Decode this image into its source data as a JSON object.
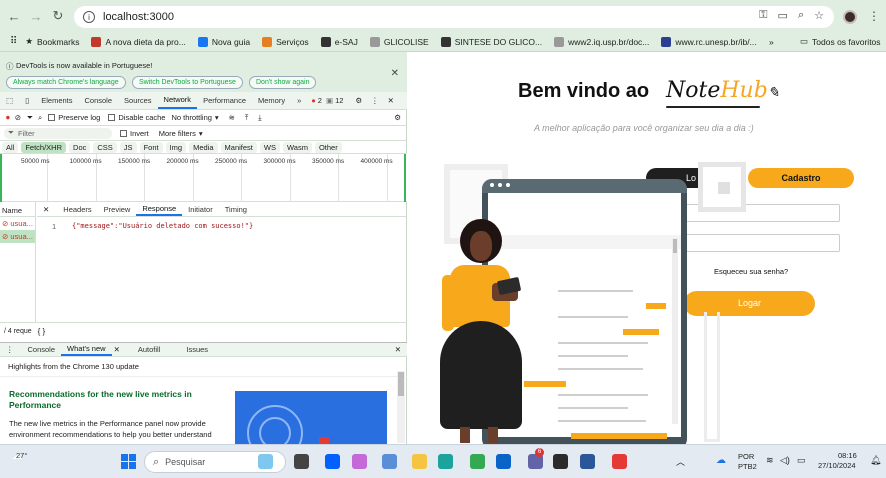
{
  "browser": {
    "url": "localhost:3000",
    "bookmarks_label": "Bookmarks",
    "bookmarks": [
      {
        "label": "A nova dieta da pro...",
        "color": "#c0392b"
      },
      {
        "label": "Nova guia",
        "color": "#1877f2"
      },
      {
        "label": "Serviços",
        "color": "#e67e22"
      },
      {
        "label": "e-SAJ",
        "color": "#333333"
      },
      {
        "label": "GLICOLISE",
        "color": "#999999"
      },
      {
        "label": "SINTESE DO GLICO...",
        "color": "#333333"
      },
      {
        "label": "www2.iq.usp.br/doc...",
        "color": "#999999"
      },
      {
        "label": "www.rc.unesp.br/ib/...",
        "color": "#2c3e90"
      }
    ],
    "all_favorites": "Todos os favoritos"
  },
  "devtools": {
    "info_text": "DevTools is now available in Portuguese!",
    "btn_match": "Always match Chrome's language",
    "btn_switch": "Switch DevTools to Portuguese",
    "btn_dont": "Don't show again",
    "tabs": [
      "Elements",
      "Console",
      "Sources",
      "Network",
      "Performance",
      "Memory"
    ],
    "errors": "2",
    "warnings": "12",
    "preserve_log": "Preserve log",
    "disable_cache": "Disable cache",
    "throttling": "No throttling",
    "filter_placeholder": "Filter",
    "invert": "Invert",
    "more_filters": "More filters",
    "type_filters": [
      "All",
      "Fetch/XHR",
      "Doc",
      "CSS",
      "JS",
      "Font",
      "Img",
      "Media",
      "Manifest",
      "WS",
      "Wasm",
      "Other"
    ],
    "timeline_ticks": [
      "50000 ms",
      "100000 ms",
      "150000 ms",
      "200000 ms",
      "250000 ms",
      "300000 ms",
      "350000 ms",
      "400000 ms"
    ],
    "name_col": "Name",
    "requests": [
      "usua...",
      "usua..."
    ],
    "detail_tabs": [
      "Headers",
      "Preview",
      "Response",
      "Initiator",
      "Timing"
    ],
    "line_no": "1",
    "response_body": "{\"message\":\"Usuário deletado com sucesso!\"}",
    "status": "/ 4 reque",
    "drawer_tabs": [
      "Console",
      "What's new",
      "Autofill",
      "Issues"
    ],
    "whats_new_heading": "Highlights from the Chrome 130 update",
    "article_title": "Recommendations for the new live metrics in Performance",
    "article_body": "The new live metrics in the Performance panel now provide environment recommendations to help you better understand"
  },
  "page": {
    "welcome": "Bem vindo ao",
    "brand_a": "Note",
    "brand_b": "Hub",
    "subtitle": "A melhor aplicação para você organizar seu dia a dia :)",
    "login_tab": "Lo",
    "signup_tab": "Cadastro",
    "forgot": "Esqueceu sua senha?",
    "submit": "Logar"
  },
  "taskbar": {
    "temp": "27°",
    "search": "Pesquisar",
    "teams_badge": "6",
    "lang_1": "POR",
    "lang_2": "PTB2",
    "time": "08:16",
    "date": "27/10/2024"
  }
}
